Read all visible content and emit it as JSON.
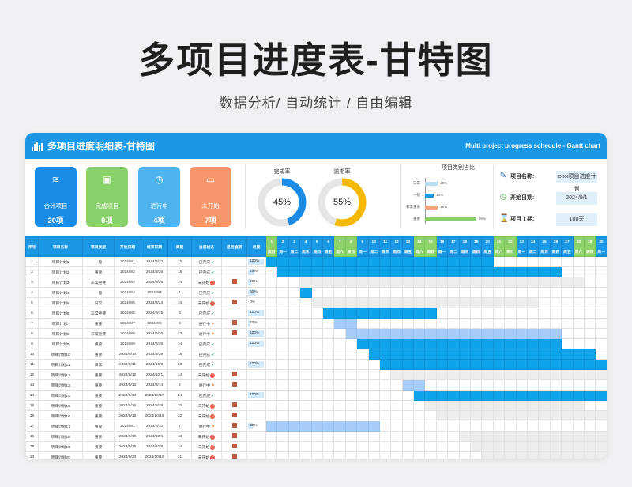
{
  "page": {
    "title": "多项目进度表-甘特图",
    "subtitle": "数据分析/ 自动统计 / 自由编辑"
  },
  "header": {
    "title": "多项目进度明细表-甘特图",
    "en_title": "Multi project progress schedule - Gantt chart",
    "icon": "bar-chart-icon"
  },
  "kpis": [
    {
      "label": "合计项目",
      "value": "20项",
      "color": "#1a8ce6",
      "icon": "layers-icon"
    },
    {
      "label": "完成项目",
      "value": "9项",
      "color": "#88d06a",
      "icon": "briefcase-icon"
    },
    {
      "label": "进行中",
      "value": "4项",
      "color": "#4cb3ec",
      "icon": "clock-icon"
    },
    {
      "label": "未开始",
      "value": "7项",
      "color": "#f7956a",
      "icon": "monitor-icon"
    }
  ],
  "rings": [
    {
      "label": "完成率",
      "value": "45%",
      "pct": 45,
      "color": "#1a8ce6"
    },
    {
      "label": "逾期率",
      "value": "55%",
      "pct": 55,
      "color": "#f5b800"
    }
  ],
  "category_chart": {
    "title": "项目类别占比",
    "items": [
      {
        "name": "日常",
        "pct": "15%",
        "value": 15,
        "color": "#b8dff5"
      },
      {
        "name": "一般",
        "pct": "10%",
        "value": 10,
        "color": "#1a98e6"
      },
      {
        "name": "非常重要",
        "pct": "15%",
        "value": 15,
        "color": "#f4a47e"
      },
      {
        "name": "重要",
        "pct": "60%",
        "value": 60,
        "color": "#88d06a"
      }
    ]
  },
  "info": [
    {
      "label": "项目名称:",
      "value": "xxxx项目进度计划",
      "icon": "edit-icon"
    },
    {
      "label": "开始日期:",
      "value": "2024/9/1",
      "icon": "clock-icon"
    },
    {
      "label": "项目工期:",
      "value": "100天",
      "icon": "hourglass-icon"
    }
  ],
  "columns": [
    "序号",
    "项目名称",
    "项目类型",
    "开始日期",
    "结束日期",
    "周期",
    "当前状态",
    "是否逾期",
    "进度"
  ],
  "days": [
    "1",
    "2",
    "3",
    "4",
    "5",
    "6",
    "7",
    "8",
    "9",
    "10",
    "11",
    "12",
    "13",
    "14",
    "15",
    "16",
    "17",
    "18",
    "19",
    "20",
    "21",
    "22",
    "23",
    "24",
    "25",
    "26",
    "27",
    "28",
    "29",
    "30"
  ],
  "weekdays": [
    "周日",
    "周一",
    "周二",
    "周三",
    "周四",
    "周五",
    "周六",
    "周日",
    "周一",
    "周二",
    "周三",
    "周四",
    "周五",
    "周六",
    "周日",
    "周一",
    "周二",
    "周三",
    "周四",
    "周五",
    "周六",
    "周日",
    "周一",
    "周二",
    "周三",
    "周四",
    "周五",
    "周六",
    "周日",
    "周一"
  ],
  "weekend_days": [
    1,
    7,
    8,
    14,
    15,
    21,
    22,
    28,
    29
  ],
  "rows": [
    {
      "no": "1",
      "name": "项目计划1",
      "type": "一般",
      "start": "2024/9/1",
      "end": "2024/9/20",
      "dur": "15",
      "status": "已完成",
      "stat": "ok",
      "overdue": false,
      "progress": "100%",
      "pct": 100,
      "gs": 1,
      "ge": 20
    },
    {
      "no": "2",
      "name": "项目计划2",
      "type": "重要",
      "start": "2024/9/2",
      "end": "2024/9/26",
      "dur": "15",
      "status": "已完成",
      "stat": "ok",
      "overdue": false,
      "progress": "40%",
      "pct": 40,
      "gs": 2,
      "ge": 26
    },
    {
      "no": "3",
      "name": "项目计划3",
      "type": "非常重要",
      "start": "2024/9/4",
      "end": "2024/9/28",
      "dur": "14",
      "status": "未开始",
      "stat": "no",
      "overdue": true,
      "progress": "20%",
      "pct": 20,
      "gs": 4,
      "ge": 28
    },
    {
      "no": "4",
      "name": "项目计划4",
      "type": "一般",
      "start": "2024/9/4",
      "end": "2024/9/4",
      "dur": "1",
      "status": "已完成",
      "stat": "ok",
      "overdue": false,
      "progress": "50%",
      "pct": 50,
      "gs": 4,
      "ge": 4
    },
    {
      "no": "5",
      "name": "项目计划5",
      "type": "日常",
      "start": "2024/9/5",
      "end": "2024/9/24",
      "dur": "14",
      "status": "未开始",
      "stat": "no",
      "overdue": true,
      "progress": "0%",
      "pct": 0,
      "gs": 5,
      "ge": 24
    },
    {
      "no": "6",
      "name": "项目计划6",
      "type": "非常重要",
      "start": "2024/9/6",
      "end": "2024/9/15",
      "dur": "6",
      "status": "已完成",
      "stat": "ok",
      "overdue": false,
      "progress": "100%",
      "pct": 100,
      "gs": 6,
      "ge": 15
    },
    {
      "no": "7",
      "name": "项目计划7",
      "type": "重要",
      "start": "2024/9/7",
      "end": "2024/9/8",
      "dur": "2",
      "status": "进行中",
      "stat": "run",
      "overdue": true,
      "progress": "10%",
      "pct": 10,
      "gs": 7,
      "ge": 8
    },
    {
      "no": "8",
      "name": "项目计划8",
      "type": "非常重要",
      "start": "2024/9/8",
      "end": "2024/9/26",
      "dur": "13",
      "status": "进行中",
      "stat": "run",
      "overdue": true,
      "progress": "100%",
      "pct": 100,
      "gs": 8,
      "ge": 26
    },
    {
      "no": "9",
      "name": "项目计划9",
      "type": "重要",
      "start": "2024/9/9",
      "end": "2024/9/26",
      "dur": "14",
      "status": "已完成",
      "stat": "ok",
      "overdue": false,
      "progress": "100%",
      "pct": 100,
      "gs": 9,
      "ge": 26
    },
    {
      "no": "10",
      "name": "项目计划10",
      "type": "重要",
      "start": "2024/9/10",
      "end": "2024/9/29",
      "dur": "15",
      "status": "已完成",
      "stat": "ok",
      "overdue": false,
      "progress": "",
      "pct": 0,
      "gs": 10,
      "ge": 29
    },
    {
      "no": "11",
      "name": "项目计划11",
      "type": "日常",
      "start": "2024/9/11",
      "end": "2024/10/8",
      "dur": "28",
      "status": "已完成",
      "stat": "ok",
      "overdue": false,
      "progress": "100%",
      "pct": 100,
      "gs": 11,
      "ge": 30
    },
    {
      "no": "12",
      "name": "项目计划12",
      "type": "重要",
      "start": "2024/9/12",
      "end": "2024/10/1",
      "dur": "14",
      "status": "未开始",
      "stat": "no",
      "overdue": true,
      "progress": "",
      "pct": 0,
      "gs": 12,
      "ge": 30
    },
    {
      "no": "13",
      "name": "项目计划13",
      "type": "重要",
      "start": "2024/9/13",
      "end": "2024/9/14",
      "dur": "2",
      "status": "进行中",
      "stat": "run",
      "overdue": true,
      "progress": "",
      "pct": 0,
      "gs": 13,
      "ge": 14
    },
    {
      "no": "14",
      "name": "项目计划14",
      "type": "重要",
      "start": "2024/9/14",
      "end": "2024/10/17",
      "dur": "24",
      "status": "已完成",
      "stat": "ok",
      "overdue": false,
      "progress": "100%",
      "pct": 100,
      "gs": 14,
      "ge": 30
    },
    {
      "no": "15",
      "name": "项目计划15",
      "type": "重要",
      "start": "2024/9/15",
      "end": "2024/9/28",
      "dur": "10",
      "status": "未开始",
      "stat": "no",
      "overdue": true,
      "progress": "",
      "pct": 0,
      "gs": 15,
      "ge": 28
    },
    {
      "no": "16",
      "name": "项目计划16",
      "type": "重要",
      "start": "2024/9/16",
      "end": "2024/10/15",
      "dur": "22",
      "status": "未开始",
      "stat": "no",
      "overdue": true,
      "progress": "",
      "pct": 0,
      "gs": 16,
      "ge": 30
    },
    {
      "no": "17",
      "name": "项目计划17",
      "type": "重要",
      "start": "2024/9/1",
      "end": "2024/9/10",
      "dur": "7",
      "status": "进行中",
      "stat": "run",
      "overdue": true,
      "progress": "30%",
      "pct": 30,
      "gs": 1,
      "ge": 10
    },
    {
      "no": "18",
      "name": "项目计划18",
      "type": "重要",
      "start": "2024/9/18",
      "end": "2024/10/4",
      "dur": "13",
      "status": "未开始",
      "stat": "no",
      "overdue": true,
      "progress": "",
      "pct": 0,
      "gs": 18,
      "ge": 30
    },
    {
      "no": "19",
      "name": "项目计划19",
      "type": "重要",
      "start": "2024/9/19",
      "end": "2024/10/8",
      "dur": "14",
      "status": "未开始",
      "stat": "no",
      "overdue": true,
      "progress": "",
      "pct": 0,
      "gs": 19,
      "ge": 30
    },
    {
      "no": "20",
      "name": "项目计划20",
      "type": "重要",
      "start": "2024/9/20",
      "end": "2024/10/10",
      "dur": "21",
      "status": "未开始",
      "stat": "no",
      "overdue": true,
      "progress": "",
      "pct": 0,
      "gs": 20,
      "ge": 30
    }
  ],
  "colors": {
    "header_blue": "#1a98e6",
    "weekend_green": "#8ed36a",
    "bar_done": "#0ea3ea",
    "bar_running": "#a6cdf7",
    "bar_todo": "#ededed"
  }
}
